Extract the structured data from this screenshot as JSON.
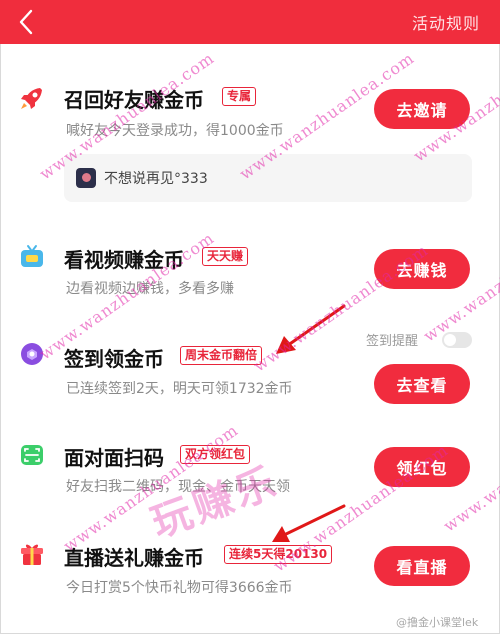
{
  "header": {
    "back_icon": "chevron-left-icon",
    "rules_label": "活动规则",
    "background": "#f02d3d"
  },
  "tasks": [
    {
      "icon": "rocket-icon",
      "title": "召回好友赚金币",
      "tag": "专属",
      "desc": "喊好友今天登录成功，得1000金币",
      "button": "去邀请"
    },
    {
      "icon": "tv-icon",
      "title": "看视频赚金币",
      "tag": "天天赚",
      "desc": "边看视频边赚钱，多看多赚",
      "button": "去赚钱"
    },
    {
      "icon": "checkin-icon",
      "title": "签到领金币",
      "tag": "周末金币翻倍",
      "desc": "已连续签到2天，明天可领1732金币",
      "button": "去查看"
    },
    {
      "icon": "scan-icon",
      "title": "面对面扫码",
      "tag": "双方领红包",
      "desc": "好友扫我二维码，现金、金币天天领",
      "button": "领红包"
    },
    {
      "icon": "gift-icon",
      "title": "直播送礼赚金币",
      "tag": "连续5天得20130",
      "desc": "今日打赏5个快币礼物可得3666金币",
      "button": "看直播"
    }
  ],
  "friend_card": {
    "name": "不想说再见°333"
  },
  "checkin_reminder": {
    "label": "签到提醒",
    "enabled": false
  },
  "watermark": {
    "text": "www.wanzhuanlea.com",
    "big_text": "玩赚乐",
    "footer": "@撸金小课堂lek"
  },
  "colors": {
    "accent": "#f12c3e",
    "tag": "#e8253a",
    "desc": "#8a8a8a"
  }
}
